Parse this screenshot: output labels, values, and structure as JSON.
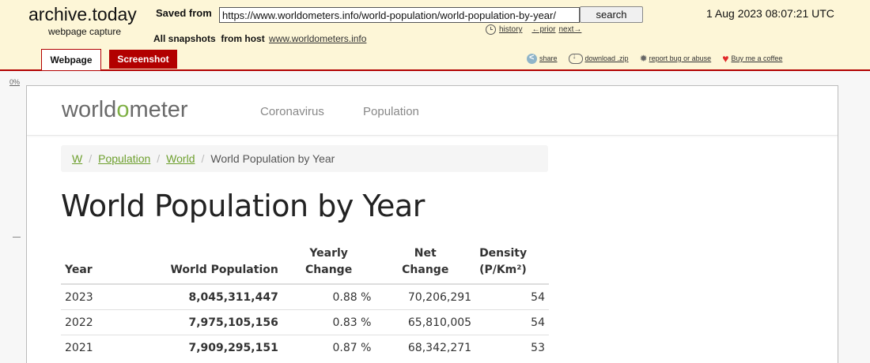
{
  "archive": {
    "brand_title": "archive.today",
    "brand_subtitle": "webpage capture",
    "saved_from_label": "Saved from",
    "url_value": "https://www.worldometers.info/world-population/world-population-by-year/",
    "search_label": "search",
    "timestamp": "1 Aug 2023 08:07:21 UTC",
    "history_label": "history",
    "prior_label": "←prior",
    "next_label": "next→",
    "all_snapshots_label": "All snapshots",
    "from_host_label": "from host",
    "host_link": "www.worldometers.info",
    "tabs": {
      "webpage": "Webpage",
      "screenshot": "Screenshot"
    },
    "actions": {
      "share": "share",
      "download": "download .zip",
      "report": "report bug or abuse",
      "coffee": "Buy me a coffee"
    },
    "ruler_top": "0%"
  },
  "site": {
    "logo_pre": "worldometer",
    "nav": {
      "coronavirus": "Coronavirus",
      "population": "Population"
    },
    "breadcrumb": {
      "home": "W",
      "population": "Population",
      "world": "World",
      "current": "World Population by Year",
      "separator": "/"
    },
    "title": "World Population by Year",
    "table": {
      "headers": {
        "year": "Year",
        "population": "World Population",
        "yearly_change_1": "Yearly",
        "yearly_change_2": "Change",
        "net_change_1": "Net",
        "net_change_2": "Change",
        "density_1": "Density",
        "density_2": "(P/Km²)"
      },
      "rows": [
        {
          "year": "2023",
          "population": "8,045,311,447",
          "yearly_change": "0.88 %",
          "net_change": "70,206,291",
          "density": "54"
        },
        {
          "year": "2022",
          "population": "7,975,105,156",
          "yearly_change": "0.83 %",
          "net_change": "65,810,005",
          "density": "54"
        },
        {
          "year": "2021",
          "population": "7,909,295,151",
          "yearly_change": "0.87 %",
          "net_change": "68,342,271",
          "density": "53"
        }
      ]
    }
  },
  "colors": {
    "archive_bg": "#fdf6d7",
    "archive_accent": "#b20000",
    "logo_green": "#7fb045",
    "link_green": "#6d9f2d"
  }
}
